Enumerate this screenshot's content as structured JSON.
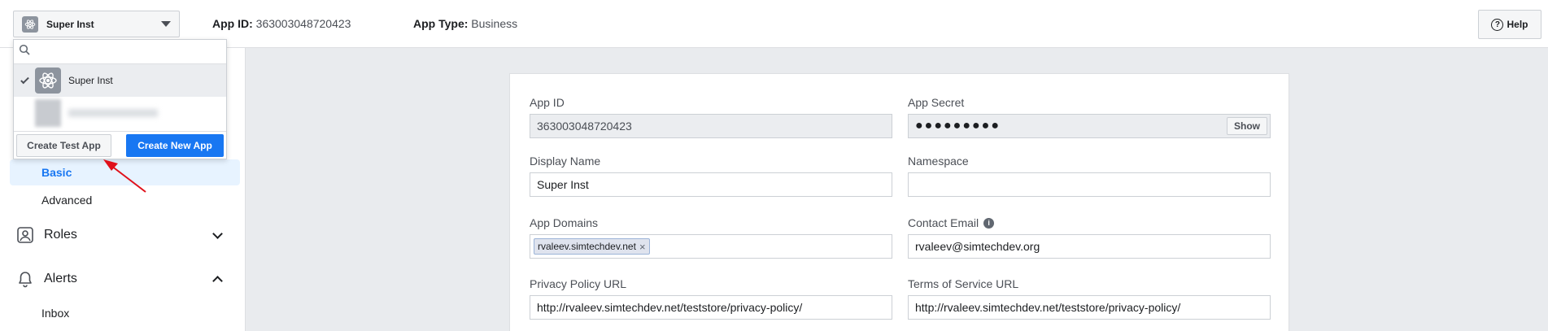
{
  "topbar": {
    "app_name": "Super Inst",
    "app_id_label": "App ID:",
    "app_id_value": "363003048720423",
    "app_type_label": "App Type:",
    "app_type_value": "Business",
    "help_label": "Help"
  },
  "dropdown": {
    "search_value": "",
    "items": [
      {
        "label": "Super Inst",
        "selected": true
      },
      {
        "label": "",
        "blurred": true
      }
    ],
    "create_test_label": "Create Test App",
    "create_new_label": "Create New App"
  },
  "sidebar": {
    "basic_label": "Basic",
    "advanced_label": "Advanced",
    "roles_label": "Roles",
    "alerts_label": "Alerts",
    "inbox_label": "Inbox"
  },
  "form": {
    "app_id": {
      "label": "App ID",
      "value": "363003048720423"
    },
    "app_secret": {
      "label": "App Secret",
      "value": "●●●●●●●●●",
      "show_label": "Show"
    },
    "display_name": {
      "label": "Display Name",
      "value": "Super Inst"
    },
    "namespace": {
      "label": "Namespace",
      "value": ""
    },
    "app_domains": {
      "label": "App Domains",
      "tokens": [
        "rvaleev.simtechdev.net"
      ],
      "remove_glyph": "×"
    },
    "contact_email": {
      "label": "Contact Email",
      "value": "rvaleev@simtechdev.org"
    },
    "privacy_url": {
      "label": "Privacy Policy URL",
      "value": "http://rvaleev.simtechdev.net/teststore/privacy-policy/"
    },
    "tos_url": {
      "label": "Terms of Service URL",
      "value": "http://rvaleev.simtechdev.net/teststore/privacy-policy/"
    }
  },
  "colors": {
    "accent": "#1877f2",
    "annotation_arrow": "#e0101a"
  }
}
